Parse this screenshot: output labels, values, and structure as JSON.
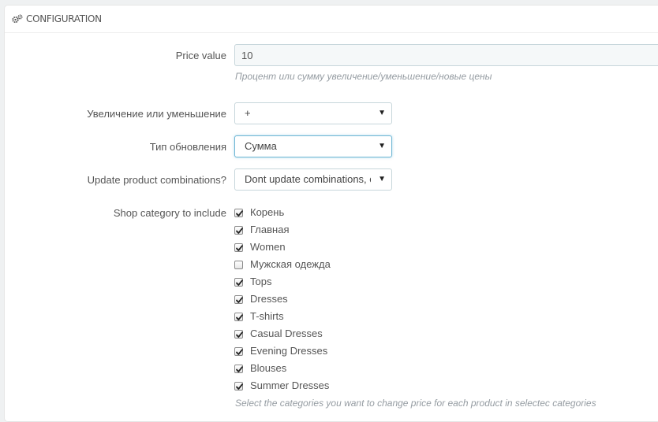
{
  "panel": {
    "title": "CONFIGURATION"
  },
  "fields": {
    "price_value": {
      "label": "Price value",
      "value": "10",
      "help": "Процент или сумму увеличение/уменьшение/новые цены"
    },
    "direction": {
      "label": "Увеличение или уменьшение",
      "selected": "+"
    },
    "update_type": {
      "label": "Тип обновления",
      "selected": "Сумма"
    },
    "combinations": {
      "label": "Update product combinations?",
      "selected": "Dont update combinations, o"
    },
    "categories": {
      "label": "Shop category to include",
      "help": "Select the categories you want to change price for each product in selectec categories",
      "items": [
        {
          "label": "Корень",
          "checked": true
        },
        {
          "label": "Главная",
          "checked": true
        },
        {
          "label": "Women",
          "checked": true
        },
        {
          "label": "Мужская одежда",
          "checked": false
        },
        {
          "label": "Tops",
          "checked": true
        },
        {
          "label": "Dresses",
          "checked": true
        },
        {
          "label": "T-shirts",
          "checked": true
        },
        {
          "label": "Casual Dresses",
          "checked": true
        },
        {
          "label": "Evening Dresses",
          "checked": true
        },
        {
          "label": "Blouses",
          "checked": true
        },
        {
          "label": "Summer Dresses",
          "checked": true
        }
      ]
    }
  },
  "icons": {
    "heading": "cogs-icon",
    "select_caret": "caret-down-icon",
    "checkbox_mark": "checkmark-icon"
  }
}
